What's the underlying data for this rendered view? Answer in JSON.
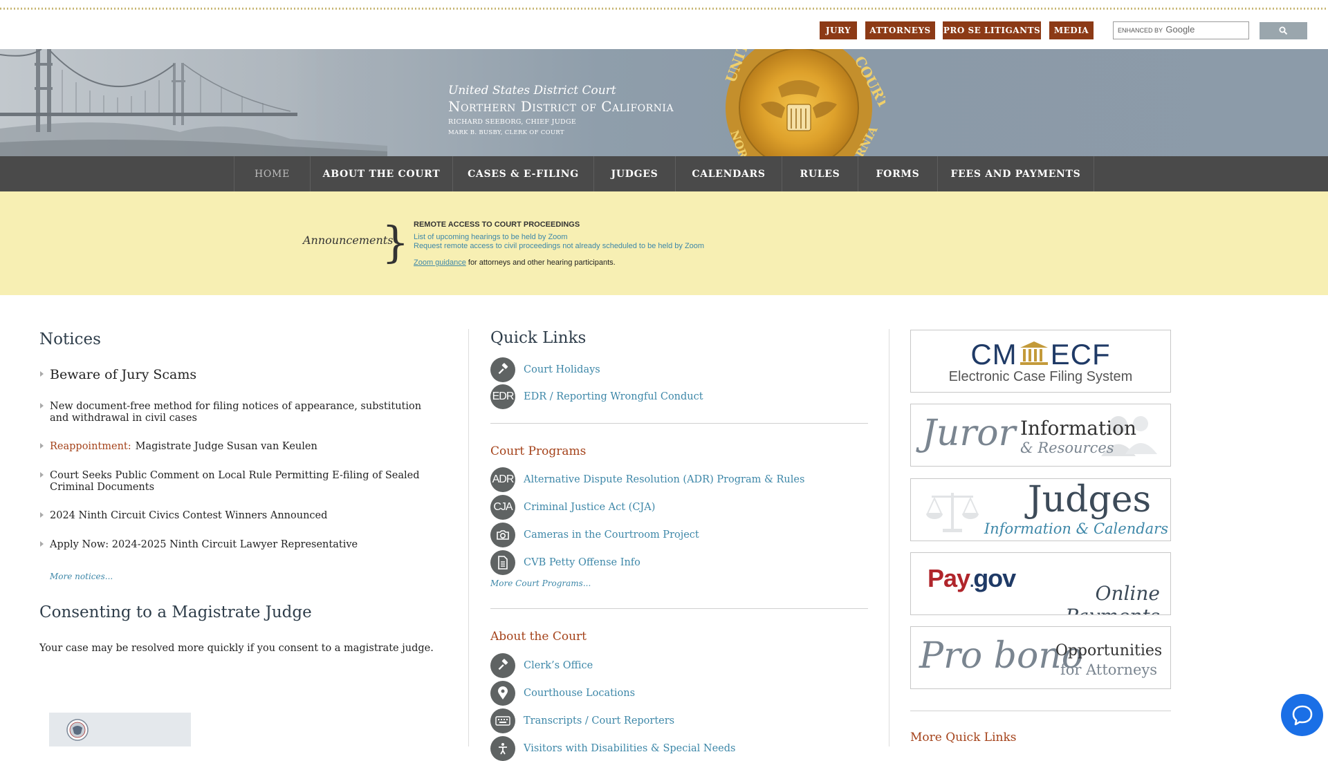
{
  "utility_nav": [
    "JURY",
    "ATTORNEYS",
    "PRO SE LITIGANTS",
    "MEDIA"
  ],
  "search": {
    "brand_prefix": "ENHANCED BY",
    "brand_name": "Google",
    "button_icon": "search-icon"
  },
  "banner": {
    "line1": "United States District Court",
    "line2": "Northern District of California",
    "judge": "RICHARD SEEBORG, CHIEF JUDGE",
    "clerk": "MARK B. BUSBY, CLERK OF COURT",
    "seal_text_left": "UNITED",
    "seal_text_right": "COURT",
    "seal_bottom_left": "NORTH",
    "seal_bottom_right": "ORNIA"
  },
  "main_nav": [
    "HOME",
    "ABOUT THE COURT",
    "CASES & E-FILING",
    "JUDGES",
    "CALENDARS",
    "RULES",
    "FORMS",
    "FEES AND PAYMENTS"
  ],
  "announcements": {
    "label": "Announcements",
    "brace": "}",
    "title": "REMOTE ACCESS TO COURT PROCEEDINGS",
    "links": [
      "List of upcoming hearings to be held by Zoom",
      "Request remote access to civil proceedings not already scheduled to be held by Zoom"
    ],
    "zoom_link": "Zoom guidance",
    "zoom_text": " for attorneys and other hearing participants."
  },
  "notices": {
    "title": "Notices",
    "items": [
      {
        "text": "Beware of Jury Scams"
      },
      {
        "text": "New document-free method for filing notices of appearance, substitution and withdrawal in civil cases"
      },
      {
        "prefix": "Reappointment:",
        "text": "Magistrate Judge Susan van Keulen"
      },
      {
        "text": "Court Seeks Public Comment on Local Rule Permitting E-filing of Sealed Criminal Documents"
      },
      {
        "text": "2024 Ninth Circuit Civics Contest Winners Announced"
      },
      {
        "text": "Apply Now: 2024-2025 Ninth Circuit Lawyer Representative"
      }
    ],
    "more": "More notices..."
  },
  "consent": {
    "title": "Consenting to a Magistrate Judge",
    "text": "Your case may be resolved more quickly if you consent to a magistrate judge."
  },
  "quick_links": {
    "title": "Quick Links",
    "items": [
      {
        "icon": "gavel-icon",
        "glyph": "",
        "label": "Court Holidays"
      },
      {
        "icon": "edr-icon",
        "glyph": "EDR",
        "label": "EDR / Reporting Wrongful Conduct"
      }
    ]
  },
  "court_programs": {
    "title": "Court Programs",
    "items": [
      {
        "icon": "adr-icon",
        "glyph": "ADR",
        "label": "Alternative Dispute Resolution (ADR) Program & Rules"
      },
      {
        "icon": "cja-icon",
        "glyph": "CJA",
        "label": "Criminal Justice Act (CJA)"
      },
      {
        "icon": "camera-icon",
        "glyph": "",
        "label": "Cameras in the Courtroom Project"
      },
      {
        "icon": "document-icon",
        "glyph": "",
        "label": "CVB Petty Offense Info"
      }
    ],
    "more": "More Court Programs..."
  },
  "about_court": {
    "title": "About the Court",
    "items": [
      {
        "icon": "gavel-icon",
        "label": "Clerk’s Office"
      },
      {
        "icon": "location-pin-icon",
        "label": "Courthouse Locations"
      },
      {
        "icon": "keyboard-icon",
        "label": "Transcripts / Court Reporters"
      },
      {
        "icon": "accessibility-icon",
        "label": "Visitors with Disabilities & Special Needs"
      }
    ]
  },
  "cards": {
    "cmecf": {
      "brand": "CM",
      "brand2": "ECF",
      "sub": "Electronic Case Filing System"
    },
    "juror": {
      "big": "Juror",
      "right1": "Information",
      "right2": "& Resources"
    },
    "judges": {
      "big": "Judges",
      "sub": "Information & Calendars"
    },
    "paygov": {
      "pay": "Pay",
      "dot": ".",
      "gov": "gov",
      "sub": "Online Payments"
    },
    "probono": {
      "big": "Pro bono",
      "right1": "Opportunities",
      "right2": "for Attorneys"
    }
  },
  "more_quick_links": "More Quick Links",
  "colors": {
    "accent_red": "#a4421a",
    "link_blue": "#3d87a8",
    "nav_bg": "#4a4a4a",
    "announce_bg": "#f7efb3",
    "util_btn": "#8c3a16",
    "chat_blue": "#1a6fe6"
  }
}
